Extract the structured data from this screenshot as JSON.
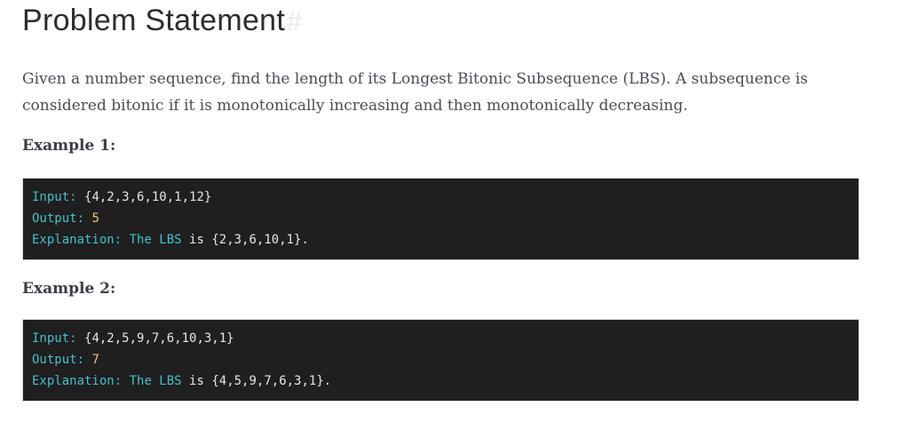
{
  "title": "Problem Statement",
  "title_anchor": "#",
  "intro": "Given a number sequence, find the length of its Longest Bitonic Subsequence (LBS). A subsequence is considered bitonic if it is monotonically increasing and then monotonically decreasing.",
  "examples": [
    {
      "heading": "Example 1:",
      "input_label": "Input:",
      "input_value": "{4,2,3,6,10,1,12}",
      "output_label": "Output:",
      "output_value": "5",
      "explanation_label": "Explanation:",
      "explanation_text": "The LBS",
      "explanation_is": "is",
      "explanation_value": "{2,3,6,10,1}."
    },
    {
      "heading": "Example 2:",
      "input_label": "Input:",
      "input_value": "{4,2,5,9,7,6,10,3,1}",
      "output_label": "Output:",
      "output_value": "7",
      "explanation_label": "Explanation:",
      "explanation_text": "The LBS",
      "explanation_is": "is",
      "explanation_value": "{4,5,9,7,6,3,1}."
    }
  ],
  "colors": {
    "code_background": "#1f1f1f",
    "code_keyword": "#3fc1c9",
    "code_text": "#e6e6e6",
    "code_number": "#f0c674"
  }
}
